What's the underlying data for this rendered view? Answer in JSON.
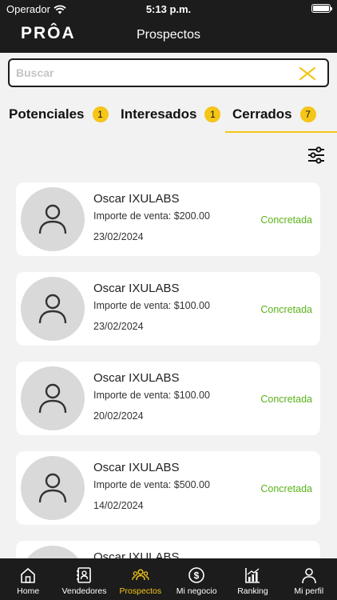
{
  "status_bar": {
    "carrier": "Operador",
    "time": "5:13 p.m."
  },
  "header": {
    "logo": "PRÔA",
    "title": "Prospectos"
  },
  "search": {
    "placeholder": "Buscar",
    "value": ""
  },
  "tabs": [
    {
      "label": "Potenciales",
      "count": "1",
      "active": false
    },
    {
      "label": "Interesados",
      "count": "1",
      "active": false
    },
    {
      "label": "Cerrados",
      "count": "7",
      "active": true
    }
  ],
  "prospects": [
    {
      "name": "Oscar IXULABS",
      "amount": "Importe de venta: $200.00",
      "date": "23/02/2024",
      "status": "Concretada"
    },
    {
      "name": "Oscar IXULABS",
      "amount": "Importe de venta: $100.00",
      "date": "23/02/2024",
      "status": "Concretada"
    },
    {
      "name": "Oscar IXULABS",
      "amount": "Importe de venta: $100.00",
      "date": "20/02/2024",
      "status": "Concretada"
    },
    {
      "name": "Oscar IXULABS",
      "amount": "Importe de venta: $500.00",
      "date": "14/02/2024",
      "status": "Concretada"
    },
    {
      "name": "Oscar IXULABS",
      "amount": "",
      "date": "",
      "status": ""
    }
  ],
  "bottom_nav": [
    {
      "label": "Home",
      "icon": "home-icon"
    },
    {
      "label": "Vendedores",
      "icon": "contacts-book-icon"
    },
    {
      "label": "Prospectos",
      "icon": "people-group-icon"
    },
    {
      "label": "Mi negocio",
      "icon": "dollar-coin-icon"
    },
    {
      "label": "Ranking",
      "icon": "chart-icon"
    },
    {
      "label": "Mi perfil",
      "icon": "person-icon"
    }
  ],
  "colors": {
    "accent": "#f5c518",
    "header_bg": "#1c1c1c",
    "success": "#5ab31a",
    "background": "#f2f2f2"
  }
}
